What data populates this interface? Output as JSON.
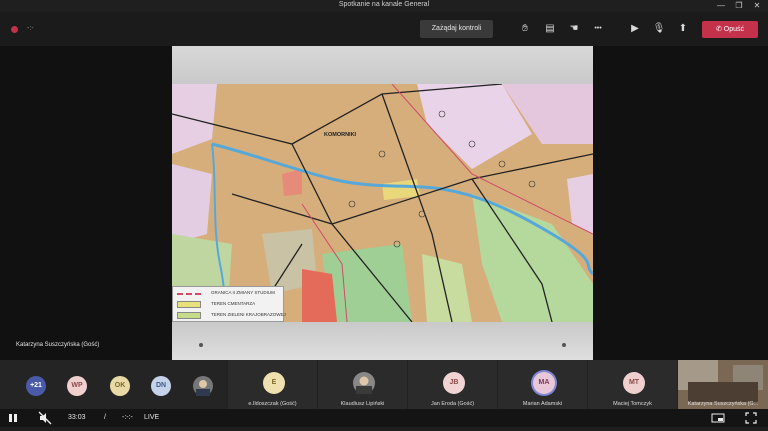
{
  "window": {
    "title": "Spotkanie na kanale General",
    "minimize": "—",
    "restore": "❐",
    "close": "✕"
  },
  "toolbar": {
    "timer": "-:-",
    "take_control_label": "Zażądaj kontroli",
    "icons": {
      "reactions": "✋︎",
      "chat": "▤",
      "raise": "☚",
      "more": "•••",
      "camera": "▶",
      "mic": "🎙︎",
      "share": "⬆"
    },
    "leave_label": "Opuść",
    "leave_icon": "✆"
  },
  "stage": {
    "presenter_name": "Katarzyna Suszczyńska (Gość)",
    "map": {
      "labels": {
        "village": "KOMORNIKI"
      },
      "legend": [
        {
          "text": "GRANICA II ZMIANY STUDIUM",
          "color": "#d04a6a"
        },
        {
          "text": "TEREN CMENTARZA",
          "color": "#e8e07a"
        },
        {
          "text": "TEREN ZIELENI KRAJOBRAZOWEJ",
          "color": "#c7dc8a"
        }
      ]
    }
  },
  "gallery": {
    "overflow_count": "+21",
    "small_avatars": [
      {
        "initials": "WP",
        "bg": "#f0cfcf",
        "fg": "#8a4a4a"
      },
      {
        "initials": "OK",
        "bg": "#e9d9a6",
        "fg": "#7a6a2a"
      },
      {
        "initials": "DN",
        "bg": "#c5d3ea",
        "fg": "#3f5a86"
      }
    ],
    "tiles": [
      {
        "initials": "E",
        "name": "e.Ildoszczak (Gość)",
        "bg": "#efe0b0",
        "fg": "#7a6a2a"
      },
      {
        "initials": "",
        "name": "Klaudiusz Lipiński",
        "bg": "#888888",
        "fg": "#ffffff"
      },
      {
        "initials": "JB",
        "name": "Jan Eroda (Gość)",
        "bg": "#f0d4d4",
        "fg": "#8a4a4a"
      },
      {
        "initials": "MA",
        "name": "Marian Adamski",
        "bg": "#e8c8d8",
        "fg": "#7a3a5a"
      },
      {
        "initials": "MT",
        "name": "Maciej Tomczyk",
        "bg": "#f0cfcf",
        "fg": "#8a4a4a"
      },
      {
        "initials": "",
        "name": "Katarzyna Suszczyńska (G...",
        "bg": "#6a5a4a",
        "fg": "#ffffff"
      }
    ]
  },
  "bottombar": {
    "time": "33:03",
    "separator": "/",
    "duration": "-:-:-",
    "live_label": "LIVE"
  }
}
